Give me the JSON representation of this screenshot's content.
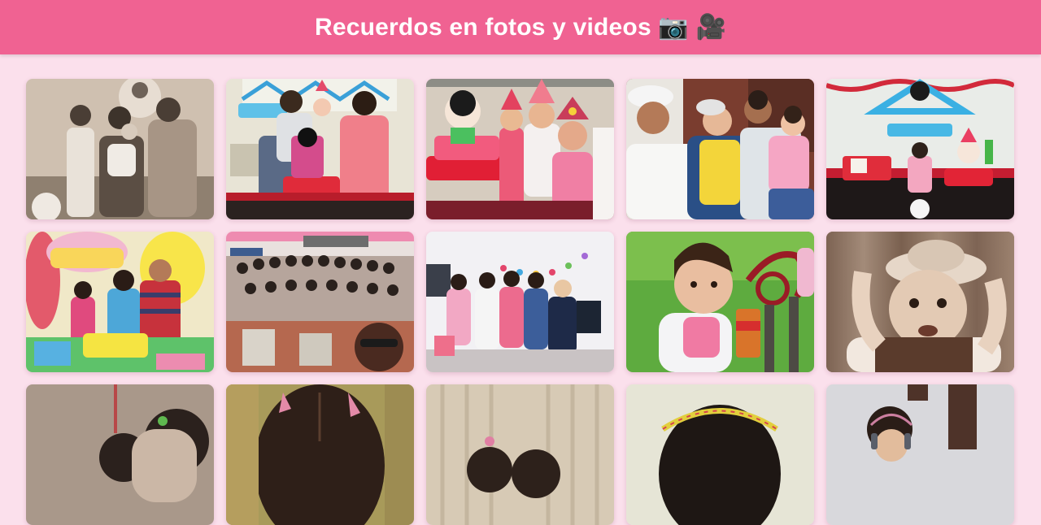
{
  "header": {
    "title": "Recuerdos en fotos y videos 📷 🎥",
    "color": "#f06292"
  },
  "gallery": {
    "items": [
      {
        "type": "photo",
        "tone": "sepia",
        "scene": "family-portrait"
      },
      {
        "type": "photo",
        "tone": "color",
        "scene": "birthday-cake-family"
      },
      {
        "type": "photo",
        "tone": "color",
        "scene": "birthday-girls-party-hats"
      },
      {
        "type": "photo",
        "tone": "color",
        "scene": "men-with-children"
      },
      {
        "type": "photo",
        "tone": "color",
        "scene": "birthday-decoration-table"
      },
      {
        "type": "photo",
        "tone": "color",
        "scene": "birthday-family-feliz-cumpleanos"
      },
      {
        "type": "photo",
        "tone": "color",
        "scene": "school-group-photo"
      },
      {
        "type": "photo",
        "tone": "color",
        "scene": "girls-party-room"
      },
      {
        "type": "photo",
        "tone": "color",
        "scene": "baby-on-grass"
      },
      {
        "type": "photo",
        "tone": "sepia",
        "scene": "baby-with-hat"
      },
      {
        "type": "photo",
        "tone": "sepia",
        "scene": "child-hair-clip"
      },
      {
        "type": "photo",
        "tone": "color",
        "scene": "child-hair-back"
      },
      {
        "type": "photo",
        "tone": "color",
        "scene": "two-children-curtain"
      },
      {
        "type": "photo",
        "tone": "color",
        "scene": "child-headband"
      },
      {
        "type": "photo",
        "tone": "color",
        "scene": "child-headphones"
      }
    ]
  },
  "colors": {
    "background": "#fbe0ec",
    "header": "#f06292"
  }
}
